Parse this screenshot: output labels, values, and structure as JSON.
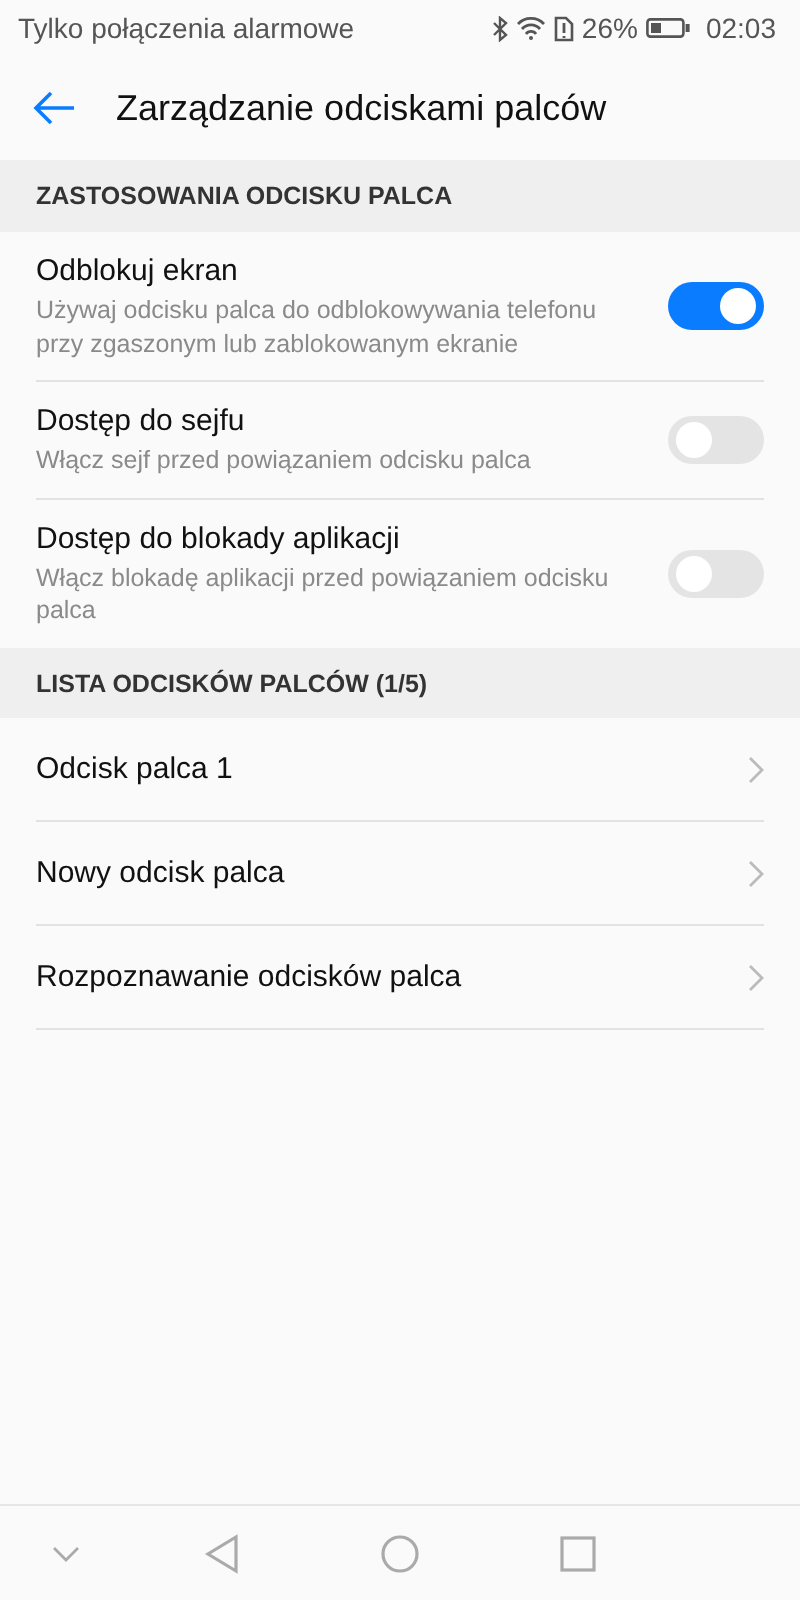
{
  "status_bar": {
    "carrier": "Tylko połączenia alarmowe",
    "battery": "26%",
    "time": "02:03"
  },
  "header": {
    "title": "Zarządzanie odciskami palców"
  },
  "sections": [
    {
      "title": "ZASTOSOWANIA ODCISKU PALCA",
      "items": [
        {
          "kind": "switch",
          "label": "Odblokuj ekran",
          "description": "Używaj odcisku palca do odblokowywania telefonu przy zgaszonym lub zablokowanym ekranie",
          "on": true
        },
        {
          "kind": "switch",
          "label": "Dostęp do sejfu",
          "description": "Włącz sejf przed powiązaniem odcisku palca",
          "on": false
        },
        {
          "kind": "switch",
          "label": "Dostęp do blokady aplikacji",
          "description": "Włącz blokadę aplikacji przed powiązaniem odcisku palca",
          "on": false
        }
      ]
    },
    {
      "title": "LISTA ODCISKÓW PALCÓW (1/5)",
      "items": [
        {
          "kind": "link",
          "label": "Odcisk palca 1"
        },
        {
          "kind": "link",
          "label": "Nowy odcisk palca"
        },
        {
          "kind": "link",
          "label": "Rozpoznawanie odcisków palca"
        }
      ]
    }
  ]
}
